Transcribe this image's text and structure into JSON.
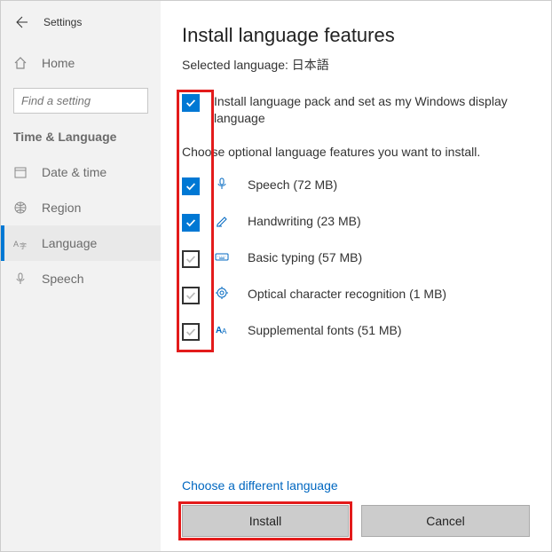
{
  "header": {
    "settings_label": "Settings"
  },
  "sidebar": {
    "home_label": "Home",
    "search_placeholder": "Find a setting",
    "section_title": "Time & Language",
    "items": [
      {
        "label": "Date & time"
      },
      {
        "label": "Region"
      },
      {
        "label": "Language"
      },
      {
        "label": "Speech"
      }
    ]
  },
  "main": {
    "title": "Install language features",
    "selected_prefix": "Selected language: ",
    "selected_language": "日本語",
    "primary_label": "Install language pack and set as my Windows display language",
    "choose_text": "Choose optional language features you want to install.",
    "features": [
      {
        "label": "Speech (72 MB)"
      },
      {
        "label": "Handwriting (23 MB)"
      },
      {
        "label": "Basic typing (57 MB)"
      },
      {
        "label": "Optical character recognition (1 MB)"
      },
      {
        "label": "Supplemental fonts (51 MB)"
      }
    ],
    "choose_different": "Choose a different language",
    "install_label": "Install",
    "cancel_label": "Cancel"
  }
}
